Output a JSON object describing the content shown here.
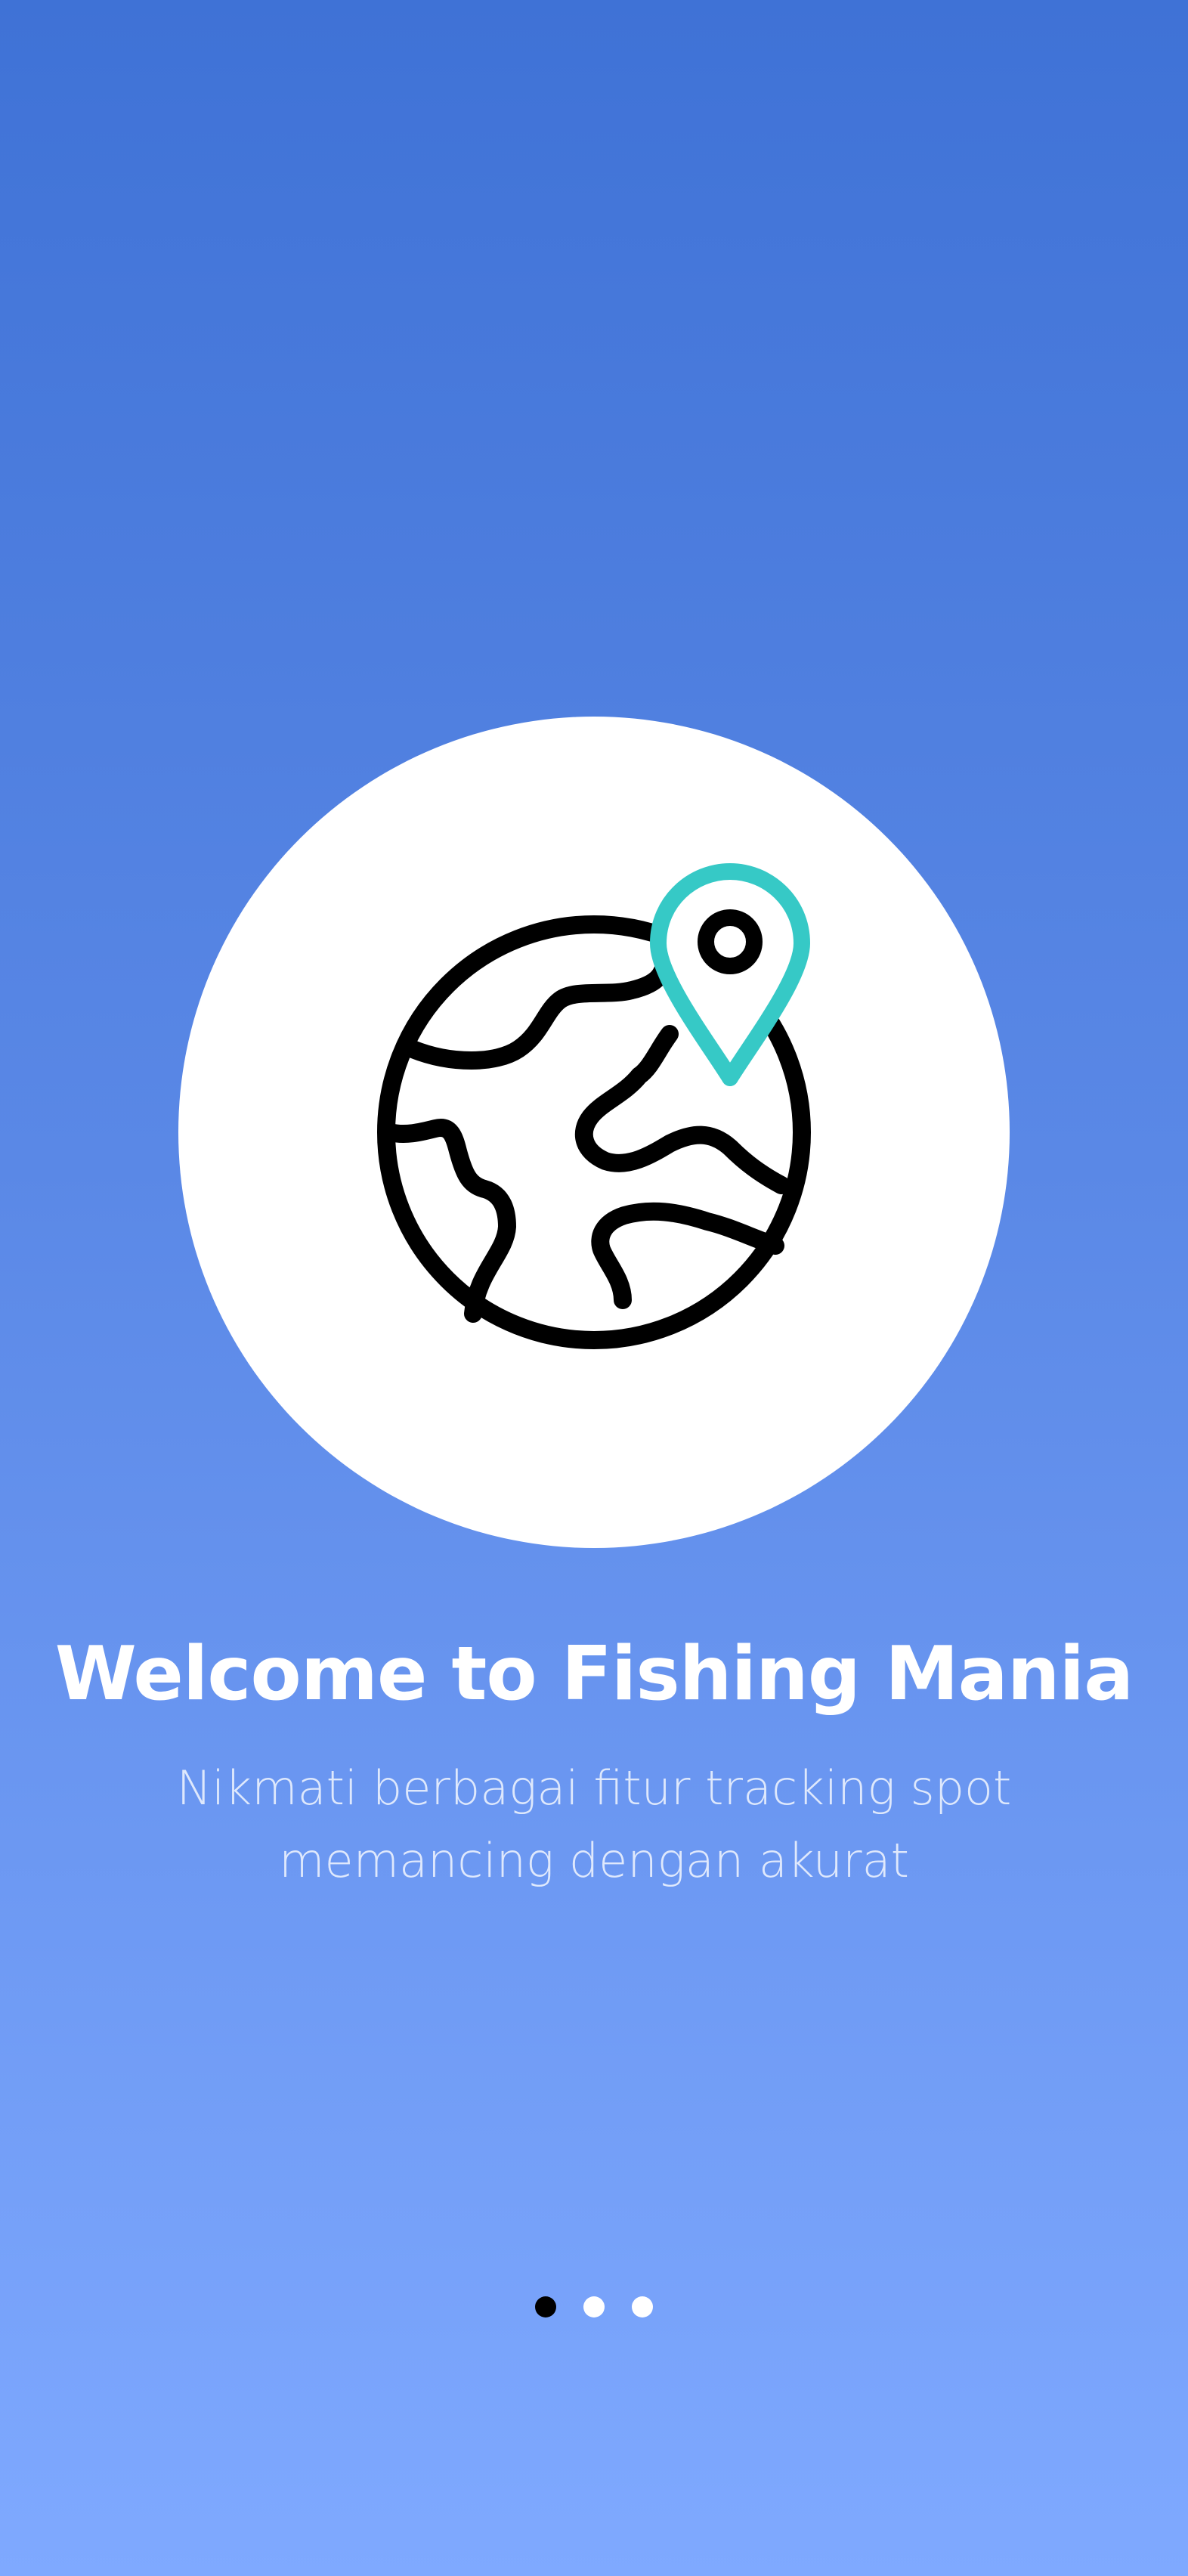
{
  "onboarding": {
    "title": "Welcome to Fishing Mania",
    "subtitle_line1": "Nikmati berbagai fitur tracking spot",
    "subtitle_line2": "memancing dengan akurat",
    "illustration_icon": "globe-with-location-pin-icon",
    "page_indicator": {
      "current_page": 1,
      "total_pages": 3
    }
  },
  "colors": {
    "background_top": "#3f72d6",
    "background_bottom": "#7fa9ff",
    "accent_pin": "#36c9c6",
    "circle": "#ffffff",
    "text": "#ffffff",
    "dot_active": "#000000",
    "dot_inactive": "#ffffff"
  }
}
